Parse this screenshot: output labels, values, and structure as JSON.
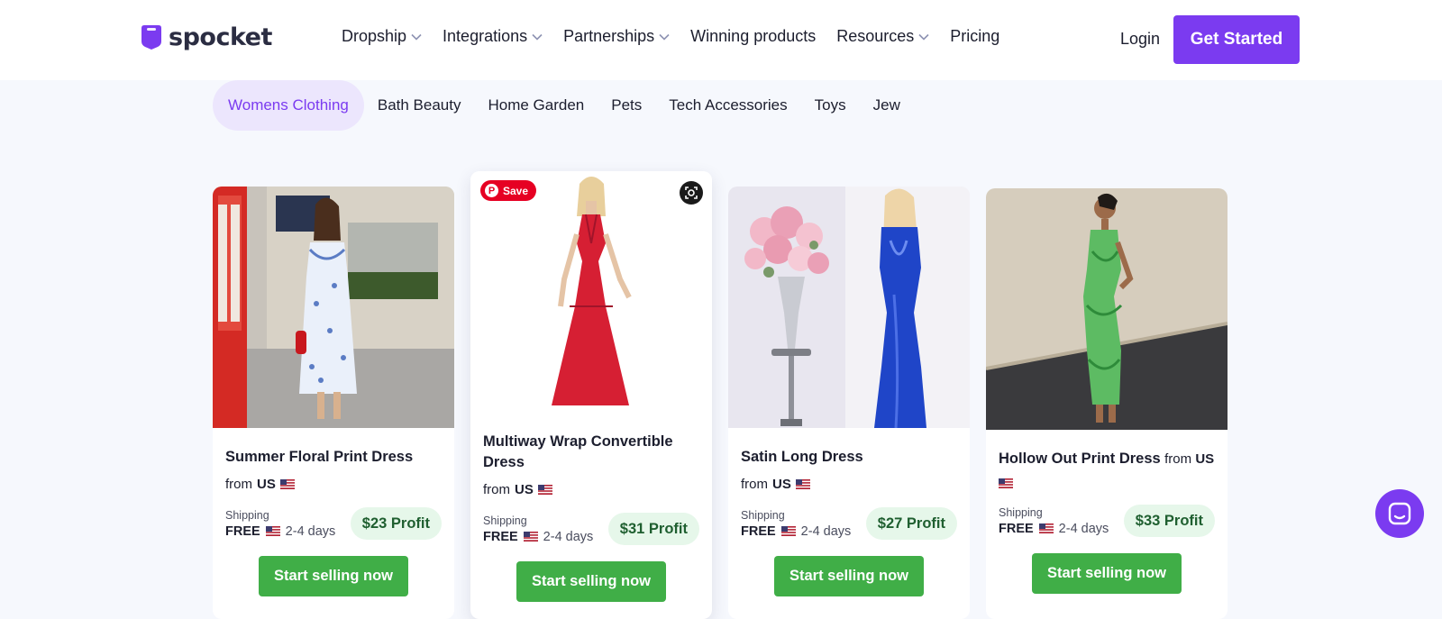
{
  "brand": {
    "name": "spocket",
    "accent": "#7b3bf0",
    "success": "#40ae47"
  },
  "header": {
    "nav": [
      {
        "label": "Dropship",
        "dropdown": true
      },
      {
        "label": "Integrations",
        "dropdown": true
      },
      {
        "label": "Partnerships",
        "dropdown": true
      },
      {
        "label": "Winning products",
        "dropdown": false
      },
      {
        "label": "Resources",
        "dropdown": true
      },
      {
        "label": "Pricing",
        "dropdown": false
      }
    ],
    "login": "Login",
    "cta": "Get Started"
  },
  "categories": {
    "active": "Womens Clothing",
    "tabs": [
      "Womens Clothing",
      "Bath Beauty",
      "Home Garden",
      "Pets",
      "Tech Accessories",
      "Toys",
      "Jew"
    ]
  },
  "products": [
    {
      "title": "Summer Floral Print Dress",
      "from_label": "from",
      "origin": "US",
      "shipping_label": "Shipping",
      "shipping_price": "FREE",
      "shipping_days": "2-4 days",
      "profit": "$23 Profit",
      "cta": "Start selling now"
    },
    {
      "title": "Multiway Wrap Convertible Dress",
      "from_label": "from",
      "origin": "US",
      "shipping_label": "Shipping",
      "shipping_price": "FREE",
      "shipping_days": "2-4 days",
      "profit": "$31 Profit",
      "cta": "Start selling now",
      "pin_label": "Save"
    },
    {
      "title": "Satin Long Dress",
      "from_label": "from",
      "origin": "US",
      "shipping_label": "Shipping",
      "shipping_price": "FREE",
      "shipping_days": "2-4 days",
      "profit": "$27 Profit",
      "cta": "Start selling now"
    },
    {
      "title": "Hollow Out Print Dress",
      "from_label": "from",
      "origin": "US",
      "shipping_label": "Shipping",
      "shipping_price": "FREE",
      "shipping_days": "2-4 days",
      "profit": "$33 Profit",
      "cta": "Start selling now"
    }
  ],
  "icons": {
    "chat": "chat-bubble-icon",
    "flag": "us-flag-icon",
    "chevron": "chevron-down-icon",
    "pinterest": "pinterest-icon",
    "lens": "visual-search-icon"
  }
}
